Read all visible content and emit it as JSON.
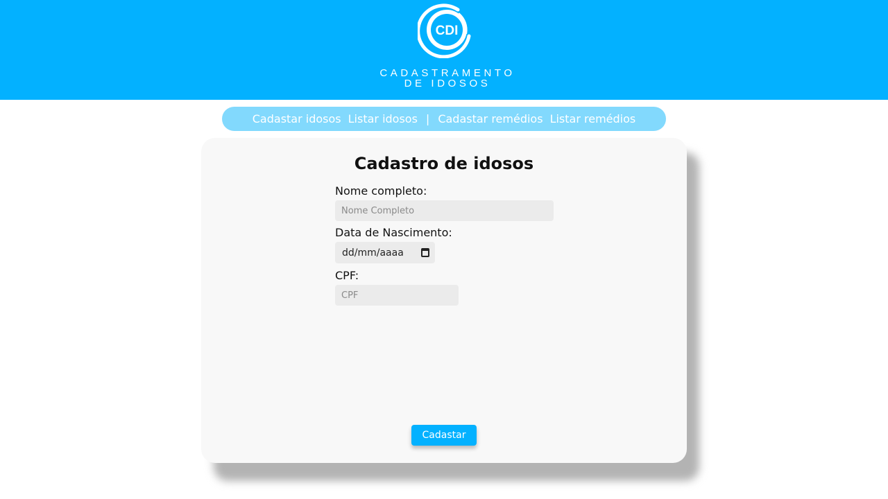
{
  "header": {
    "logo_text": "CDI",
    "caption_line1": "Cadastramento",
    "caption_line2": "de idosos",
    "background": "#03b1ff"
  },
  "nav": {
    "items": [
      {
        "label": "Cadastar idosos"
      },
      {
        "label": "Listar idosos"
      },
      {
        "label": "Cadastar remédios"
      },
      {
        "label": "Listar remédios"
      }
    ],
    "separator": "|"
  },
  "form": {
    "title": "Cadastro de idosos",
    "name_label": "Nome completo:",
    "name_placeholder": "Nome Completo",
    "name_value": "",
    "birth_label": "Data de Nascimento:",
    "birth_format": "dd/mm/aaaa",
    "birth_icon": "calendar-icon",
    "cpf_label": "CPF:",
    "cpf_placeholder": "CPF",
    "cpf_value": "",
    "submit_label": "Cadastar"
  },
  "colors": {
    "accent": "#03b1ff",
    "nav_bg": "#82d9fd",
    "card_bg": "#f8f8f8"
  }
}
